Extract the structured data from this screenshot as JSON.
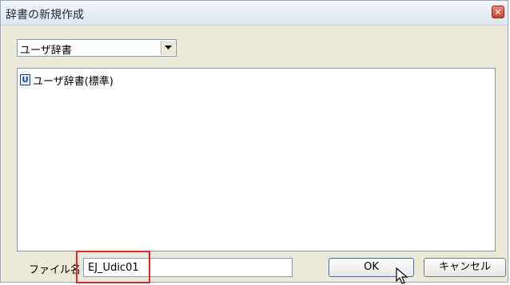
{
  "window": {
    "title": "辞書の新規作成",
    "close_glyph": "✕"
  },
  "dictionary_type": {
    "selected": "ユーザ辞書",
    "arrow_icon": "chevron-down-icon"
  },
  "dictionary_list": {
    "items": [
      {
        "icon_letter": "U",
        "label": "ユーザ辞書(標準)"
      }
    ]
  },
  "file_name": {
    "label": "ファイル名",
    "value": "EJ_Udic01"
  },
  "buttons": {
    "ok": "OK",
    "cancel": "キャンセル"
  },
  "colors": {
    "highlight": "#e0262f",
    "close_button": "#c8442c",
    "field_border": "#7f9db9"
  }
}
